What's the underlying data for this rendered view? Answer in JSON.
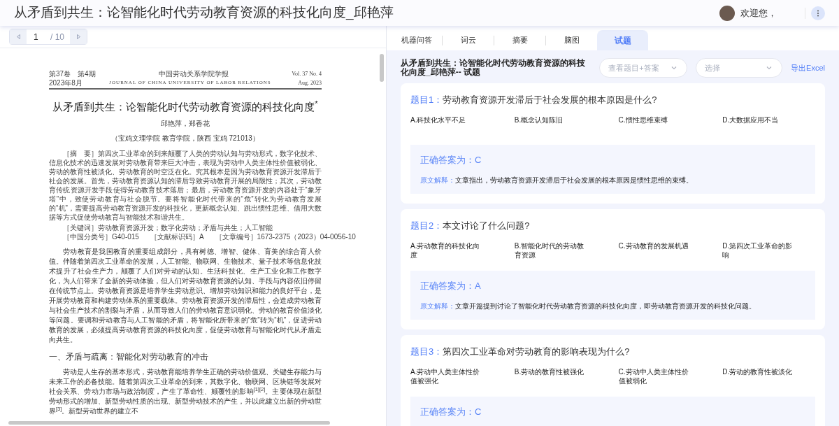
{
  "header": {
    "title": "从矛盾到共生：论智能化时代劳动教育资源的科技化向度_邱艳萍",
    "welcome": "欢迎您，"
  },
  "pager": {
    "page": "1",
    "total": "/ 10"
  },
  "document": {
    "masthead": [
      [
        "第37卷　第4期",
        "中国劳动关系学院学报",
        "Vol. 37 No. 4"
      ],
      [
        "2023年8月",
        "JOURNAL OF CHINA UNIVERSITY OF LABOR RELATIONS",
        "Aug. 2023"
      ]
    ],
    "title": "从矛盾到共生：论智能化时代劳动教育资源的科技化向度$^{*}$",
    "authors": "邱艳萍，郑香花",
    "affiliation": "（宝鸡文理学院 教育学院，陕西 宝鸡 721013）",
    "abstract": "［摘　要］第四次工业革命的到来颠覆了人类的劳动认知与劳动形式，数字化技术、信息化技术的迅速发展对劳动教育带来巨大冲击，表现为劳动中人类主体性价值被弱化、劳动的教育性被淡化、劳动教育的时空泛在化。究其根本是因为劳动教育资源开发滞后于社会的发展。首先，劳动教育资源认知的滞后导致劳动教育开展的局限性；其次，劳动教育传统资源开发手段使得劳动教育技术落后；最后，劳动教育资源开发的内容处于“象牙塔”中，致使劳动教育与社会脱节。要将智能化时代带来的“危”转化为劳动教育发展的“机”，需要提高劳动教育资源开发的科技化，更新概念认知、跳出惯性思维、借用大数据等方式促使劳动教育与智能技术和谐共生。",
    "keywords": "［关键词］劳动教育资源开发；数字化劳动；矛盾与共生；人工智能",
    "codes": [
      "［中国分类号］G40-015",
      "［文献标识码］A",
      "［文章编号］1673-2375（2023）04-0056-10"
    ],
    "body": [
      "劳动教育是我国教育的重要组成部分，具有树德、增智、健体、育美的综合育人价值。伴随着第四次工业革命的发展，人工智能、物联网、生物技术、量子技术等信息化技术提升了社会生产力，颠覆了人们对劳动的认知。生活科技化、生产工业化和工作数字化，为人们带来了全新的劳动体验，但人们对劳动教育资源的认知、手段与内容依旧停留在传统节点上。劳动教育资源是培养学生劳动意识、增加劳动知识和能力的良好平台，是开展劳动教育和构建劳动体系的重要载体。劳动教育资源开发的滞后性，会造成劳动教育与社会生产技术的割裂与矛盾，从而导致人们的劳动教育意识弱化、劳动的教育价值淡化等问题。要调和劳动教育与人工智能的矛盾，将智能化所带来的“危”转为“机”，促进劳动教育的发展，必须提高劳动教育资源的科技化向度，促使劳动教育与智能化时代从矛盾走向共生。"
    ],
    "heading": "一、矛盾与疏离：智能化对劳动教育的冲击",
    "body2": "劳动是人生存的基本形式，劳动教育能培养学生正确的劳动价值观、关键生存能力与未来工作的必备技能。随着第四次工业革命的到来，其数字化、物联网、区块链等发展对社会关系、劳动力市场与政治制度，产生了革命性、颠覆性的影响$^{[1][2]}$。主要体现在新型劳动形式的增加、新型劳动性质的出现、新型劳动技术的产生，并以此建立出新的劳动世界$^{[3]}$。新型劳动世界的建立不"
  },
  "tabs": [
    {
      "label": "机器问答",
      "selected": false
    },
    {
      "label": "词云",
      "selected": false
    },
    {
      "label": "摘要",
      "selected": false
    },
    {
      "label": "脑图",
      "selected": false
    },
    {
      "label": "试题",
      "selected": true
    }
  ],
  "panel": {
    "title": "从矛盾到共生：论智能化时代劳动教育资源的科技化向度_邱艳萍-- 试题",
    "view_select": {
      "placeholder": "查看题目+答案"
    },
    "type_select": {
      "placeholder": "选择"
    },
    "export": "导出Excel"
  },
  "questions": [
    {
      "label": "题目1：",
      "text": "劳动教育资源开发滞后于社会发展的根本原因是什么?",
      "options": [
        "A.科技化水平不足",
        "B.概念认知陈旧",
        "C.惯性思维束缚",
        "D.大数据应用不当"
      ],
      "answer": "正确答案为：C",
      "explanation_label": "原文解释：",
      "explanation": "文章指出，劳动教育资源开发滞后于社会发展的根本原因是惯性思维的束缚。"
    },
    {
      "label": "题目2：",
      "text": "本文讨论了什么问题?",
      "options": [
        "A.劳动教育的科技化向度",
        "B.智能化时代的劳动教育资源",
        "C.劳动教育的发展机遇",
        "D.第四次工业革命的影响"
      ],
      "answer": "正确答案为：A",
      "explanation_label": "原文解释：",
      "explanation": "文章开篇提到讨论了智能化时代劳动教育资源的科技化向度，即劳动教育资源开发的科技化问题。"
    },
    {
      "label": "题目3：",
      "text": "第四次工业革命对劳动教育的影响表现为什么?",
      "options": [
        "A.劳动中人类主体性价值被强化",
        "B.劳动的教育性被强化",
        "C.劳动中人类主体性价值被弱化",
        "D.劳动的教育性被淡化"
      ],
      "answer": "正确答案为：C"
    }
  ]
}
